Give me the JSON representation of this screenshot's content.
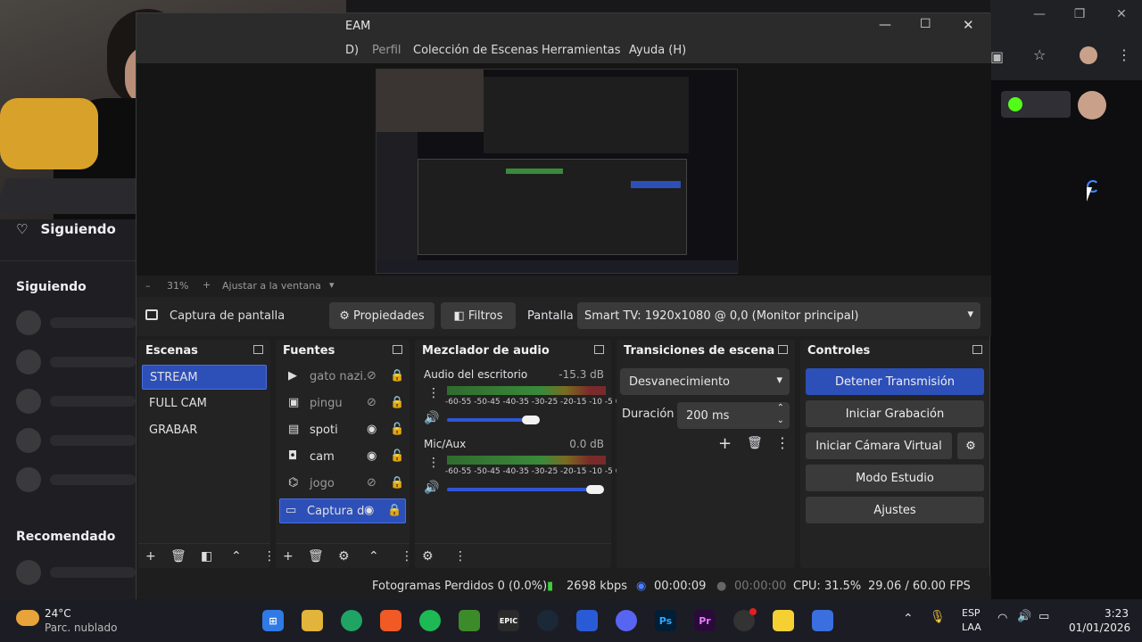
{
  "browser": {
    "following_title": "Siguiendo",
    "sidebar_heading": "Siguiendo",
    "recommended_heading": "Recomendado"
  },
  "obs": {
    "title": "EAM",
    "menu": [
      "D)",
      "Perfil",
      "Colección de Escenas",
      "Herramientas",
      "Ayuda (H)"
    ],
    "zoom": {
      "minus": "–",
      "value": "31%",
      "plus": "+",
      "fit_label": "Ajustar a la ventana"
    },
    "source_bar": {
      "selected_source": "Captura de pantalla",
      "properties_label": "Propiedades",
      "filters_label": "Filtros",
      "display_label": "Pantalla",
      "display_value": "Smart TV: 1920x1080 @ 0,0 (Monitor principal)"
    },
    "scenes": {
      "title": "Escenas",
      "items": [
        "STREAM",
        "FULL CAM",
        "GRABAR"
      ],
      "selected_index": 0
    },
    "sources": {
      "title": "Fuentes",
      "items": [
        {
          "name": "gato nazi.",
          "icon": "play-icon",
          "visible": false,
          "locked": true
        },
        {
          "name": "pingu",
          "icon": "image-icon",
          "visible": false,
          "locked": true
        },
        {
          "name": "spoti",
          "icon": "window-icon",
          "visible": true,
          "locked": false
        },
        {
          "name": "cam",
          "icon": "camera-icon",
          "visible": true,
          "locked": false
        },
        {
          "name": "jogo",
          "icon": "gamepad-icon",
          "visible": false,
          "locked": true
        },
        {
          "name": "Captura d",
          "icon": "monitor-icon",
          "visible": true,
          "locked": true
        }
      ]
    },
    "mixer": {
      "title": "Mezclador de audio",
      "channels": [
        {
          "name": "Audio del escritorio",
          "db": "-15.3 dB",
          "level": 0.82,
          "volume": 0.8
        },
        {
          "name": "Mic/Aux",
          "db": "0.0 dB",
          "level": 0.85,
          "volume": 1.0
        }
      ],
      "scale": "-60-55 -50-45 -40-35 -30-25 -20-15 -10 -5  0"
    },
    "transitions": {
      "title": "Transiciones de escena",
      "selected": "Desvanecimiento",
      "duration_label": "Duración",
      "duration_value": "200 ms"
    },
    "controls": {
      "title": "Controles",
      "stop_stream": "Detener Transmisión",
      "start_recording": "Iniciar Grabación",
      "virtual_cam": "Iniciar Cámara Virtual",
      "studio_mode": "Modo Estudio",
      "settings": "Ajustes"
    },
    "status": {
      "dropped_frames": "Fotogramas Perdidos 0 (0.0%)",
      "bitrate": "2698 kbps",
      "stream_time": "00:00:09",
      "rec_time": "00:00:00",
      "cpu": "CPU: 31.5%",
      "fps": "29.06 / 60.00 FPS"
    }
  },
  "taskbar": {
    "weather_temp": "24°C",
    "weather_desc": "Parc. nublado",
    "lang": "ESP",
    "layout": "LAA",
    "time": "3:23",
    "date": "01/01/2026",
    "apps": [
      "windows-start",
      "file-explorer",
      "chrome",
      "brave",
      "spotify",
      "minecraft",
      "epic-games",
      "steam",
      "app",
      "discord",
      "photoshop",
      "premiere",
      "obs",
      "sticky-notes",
      "roblox"
    ]
  },
  "colors": {
    "accent": "#2d4fb8",
    "obs_bg": "#1e1e1e",
    "taskbar": "#1c1c24"
  }
}
